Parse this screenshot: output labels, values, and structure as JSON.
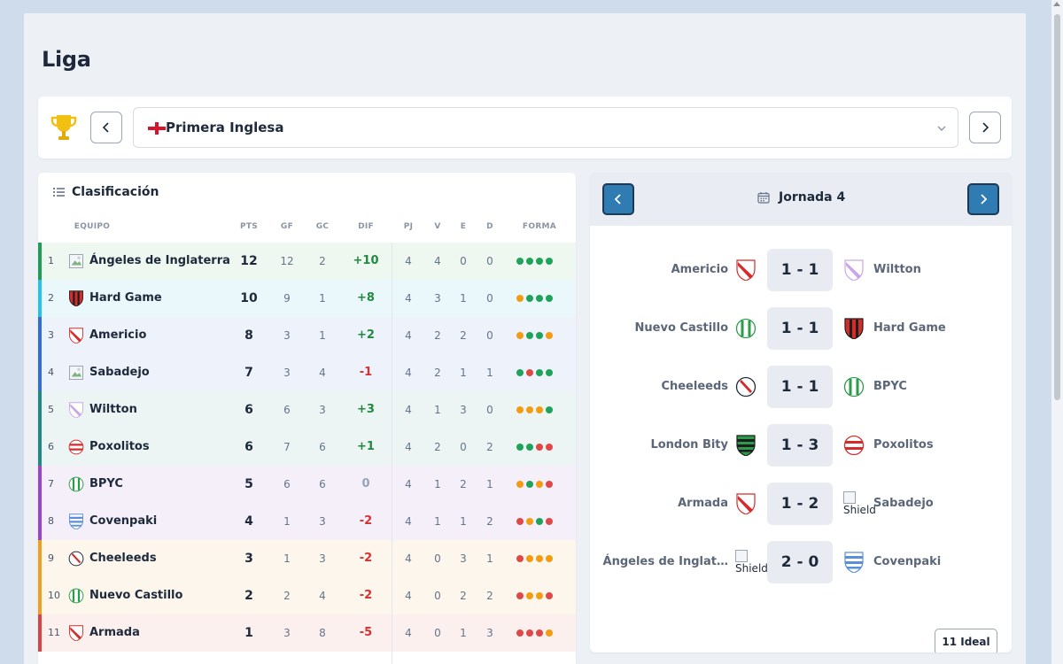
{
  "page": {
    "title": "Liga"
  },
  "league": {
    "name": "Primera Inglesa",
    "flag": "england-flag-icon"
  },
  "standings": {
    "title": "Clasificación",
    "columns": {
      "team": "EQUIPO",
      "pts": "PTS",
      "gf": "GF",
      "gc": "GC",
      "dif": "DIF",
      "pj": "PJ",
      "v": "V",
      "e": "E",
      "d": "D",
      "form": "FORMA"
    },
    "rows": [
      {
        "pos": "1",
        "team": "Ángeles de Inglaterra",
        "crest": "broken-image",
        "pts": "12",
        "gf": "12",
        "gc": "2",
        "dif": "+10",
        "pj": "4",
        "v": "4",
        "e": "0",
        "d": "0",
        "form": [
          "W",
          "W",
          "W",
          "W"
        ],
        "zone": "#1f9d55",
        "bg": "#eef8f1"
      },
      {
        "pos": "2",
        "team": "Hard Game",
        "crest": "stripes-red-black",
        "pts": "10",
        "gf": "9",
        "gc": "1",
        "dif": "+8",
        "pj": "4",
        "v": "3",
        "e": "1",
        "d": "0",
        "form": [
          "D",
          "W",
          "W",
          "W"
        ],
        "zone": "#22c3e6",
        "bg": "#eaf8fb"
      },
      {
        "pos": "3",
        "team": "Americio",
        "crest": "sash-red",
        "pts": "8",
        "gf": "3",
        "gc": "1",
        "dif": "+2",
        "pj": "4",
        "v": "2",
        "e": "2",
        "d": "0",
        "form": [
          "D",
          "W",
          "W",
          "D"
        ],
        "zone": "#2f6fd6",
        "bg": "#eef3fb"
      },
      {
        "pos": "4",
        "team": "Sabadejo",
        "crest": "broken-image",
        "pts": "7",
        "gf": "3",
        "gc": "4",
        "dif": "-1",
        "pj": "4",
        "v": "2",
        "e": "1",
        "d": "1",
        "form": [
          "W",
          "L",
          "W",
          "W"
        ],
        "zone": "#2f6fd6",
        "bg": "#eef3fb"
      },
      {
        "pos": "5",
        "team": "Wiltton",
        "crest": "sash-lilac",
        "pts": "6",
        "gf": "6",
        "gc": "3",
        "dif": "+3",
        "pj": "4",
        "v": "1",
        "e": "3",
        "d": "0",
        "form": [
          "D",
          "D",
          "D",
          "W"
        ],
        "zone": "#1f8a84",
        "bg": "#edf5f4"
      },
      {
        "pos": "6",
        "team": "Poxolitos",
        "crest": "hoops-red",
        "pts": "6",
        "gf": "7",
        "gc": "6",
        "dif": "+1",
        "pj": "4",
        "v": "2",
        "e": "0",
        "d": "2",
        "form": [
          "W",
          "W",
          "L",
          "L"
        ],
        "zone": "#1f8a84",
        "bg": "#edf5f4"
      },
      {
        "pos": "7",
        "team": "BPYC",
        "crest": "stripes-green",
        "pts": "5",
        "gf": "6",
        "gc": "6",
        "dif": "0",
        "pj": "4",
        "v": "1",
        "e": "2",
        "d": "1",
        "form": [
          "D",
          "W",
          "D",
          "L"
        ],
        "zone": "#9b45c9",
        "bg": "#f5effa"
      },
      {
        "pos": "8",
        "team": "Covenpaki",
        "crest": "hoops-blue",
        "pts": "4",
        "gf": "1",
        "gc": "3",
        "dif": "-2",
        "pj": "4",
        "v": "1",
        "e": "1",
        "d": "2",
        "form": [
          "L",
          "D",
          "W",
          "L"
        ],
        "zone": "#9b45c9",
        "bg": "#f5effa"
      },
      {
        "pos": "9",
        "team": "Cheeleeds",
        "crest": "sash-red-circle",
        "pts": "3",
        "gf": "1",
        "gc": "3",
        "dif": "-2",
        "pj": "4",
        "v": "0",
        "e": "3",
        "d": "1",
        "form": [
          "L",
          "D",
          "D",
          "D"
        ],
        "zone": "#f0a020",
        "bg": "#fdf6ec"
      },
      {
        "pos": "10",
        "team": "Nuevo Castillo",
        "crest": "stripes-green",
        "pts": "2",
        "gf": "2",
        "gc": "4",
        "dif": "-2",
        "pj": "4",
        "v": "0",
        "e": "2",
        "d": "2",
        "form": [
          "L",
          "D",
          "D",
          "L"
        ],
        "zone": "#f0a020",
        "bg": "#fdf6ec"
      },
      {
        "pos": "11",
        "team": "Armada",
        "crest": "sash-red",
        "pts": "1",
        "gf": "3",
        "gc": "8",
        "dif": "-5",
        "pj": "4",
        "v": "0",
        "e": "1",
        "d": "3",
        "form": [
          "L",
          "L",
          "L",
          "D"
        ],
        "zone": "#d64545",
        "bg": "#fcf0ef"
      }
    ]
  },
  "fixtures": {
    "round_label": "Jornada 4",
    "matches": [
      {
        "home": "Americio",
        "home_crest": "sash-red",
        "score": "1 - 1",
        "away": "Wiltton",
        "away_crest": "sash-lilac"
      },
      {
        "home": "Nuevo Castillo",
        "home_crest": "stripes-green",
        "score": "1 - 1",
        "away": "Hard Game",
        "away_crest": "stripes-red-black"
      },
      {
        "home": "Cheeleeds",
        "home_crest": "sash-red-circle",
        "score": "1 - 1",
        "away": "BPYC",
        "away_crest": "stripes-green"
      },
      {
        "home": "London Bity",
        "home_crest": "hoops-green-black",
        "score": "1 - 3",
        "away": "Poxolitos",
        "away_crest": "hoops-red"
      },
      {
        "home": "Armada",
        "home_crest": "sash-red",
        "score": "1 - 2",
        "away": "Sabadejo",
        "away_crest": "broken-image"
      },
      {
        "home": "Ángeles de Inglat…",
        "home_crest": "broken-image",
        "score": "2 - 0",
        "away": "Covenpaki",
        "away_crest": "hoops-blue"
      }
    ],
    "broken_alt": "Shield",
    "ideal_label": "11 Ideal"
  },
  "form_colors": {
    "W": "#1fa35a",
    "D": "#f39c12",
    "L": "#e04848"
  },
  "icons": [
    "trophy-icon",
    "chevron-left-icon",
    "chevron-right-icon",
    "chevron-down-icon",
    "list-icon",
    "calendar-icon"
  ]
}
